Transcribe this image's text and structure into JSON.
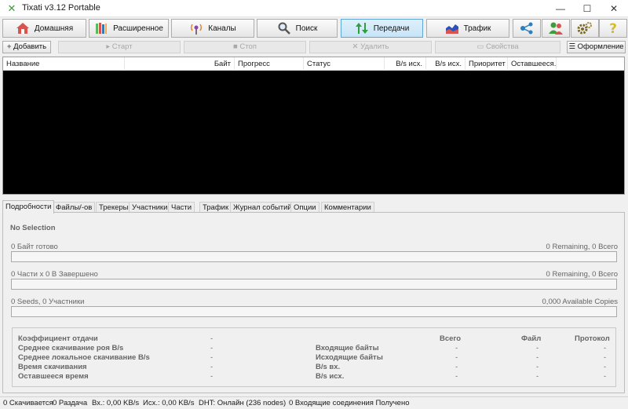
{
  "window": {
    "title": "Tixati v3.12 Portable",
    "minimize": "—",
    "maximize": "☐",
    "close": "✕"
  },
  "nav": {
    "home": "Домашняя",
    "advanced": "Расширенное",
    "channels": "Каналы",
    "search": "Поиск",
    "transfers": "Передачи",
    "traffic": "Трафик"
  },
  "toolbar": {
    "add": "Добавить",
    "start": "Старт",
    "stop": "Стоп",
    "remove": "Удалить",
    "properties": "Свойства",
    "layout": "Оформление"
  },
  "columns": {
    "name": "Название",
    "bytes": "Байт",
    "progress": "Прогресс",
    "status": "Статус",
    "bps_out": "B/s исх.",
    "bps_out2": "B/s исх.",
    "priority": "Приоритет",
    "remaining": "Оставшееся..."
  },
  "tabs": [
    "Подробности",
    "Файлы/-ов",
    "Трекеры",
    "Участники",
    "Части",
    "Трафик",
    "Журнал событий",
    "Опции",
    "Комментарии"
  ],
  "details": {
    "no_selection": "No Selection",
    "bytes_done": "0 Байт готово",
    "bytes_remaining": "0 Remaining,  0 Всего",
    "pieces_done": "0 Части  x  0 В Завершено",
    "pieces_remaining": "0 Remaining,  0 Всего",
    "seeds_peers": "0 Seeds, 0 Участники",
    "available_copies": "0,000 Available Copies"
  },
  "stats": {
    "ratio": "Коэффициент отдачи",
    "swarm_avg_dl": "Среднее скачивание роя B/s",
    "local_avg_dl": "Среднее локальное скачивание B/s",
    "dl_time": "Время скачивания",
    "time_left": "Оставшееся время",
    "dash": "-",
    "total_header": "Всего",
    "file_header": "Файл",
    "protocol_header": "Протокол",
    "bytes_in": "Входящие байты",
    "bytes_out": "Исходящие байты",
    "bps_in": "B/s вх.",
    "bps_out": "B/s исх."
  },
  "status": {
    "downloading": "0 Скачивается",
    "seeding": "0 Раздача",
    "in_rate": "Вх.: 0,00 KB/s",
    "out_rate": "Исх.: 0,00 KB/s",
    "dht": "DHT: Онлайн (236 nodes)",
    "incoming": "0 Входящие соединения Получено"
  },
  "colors": {
    "accent": "#5ea6d6",
    "active_bg": "#c6e4f7",
    "list_bg": "#000000"
  }
}
